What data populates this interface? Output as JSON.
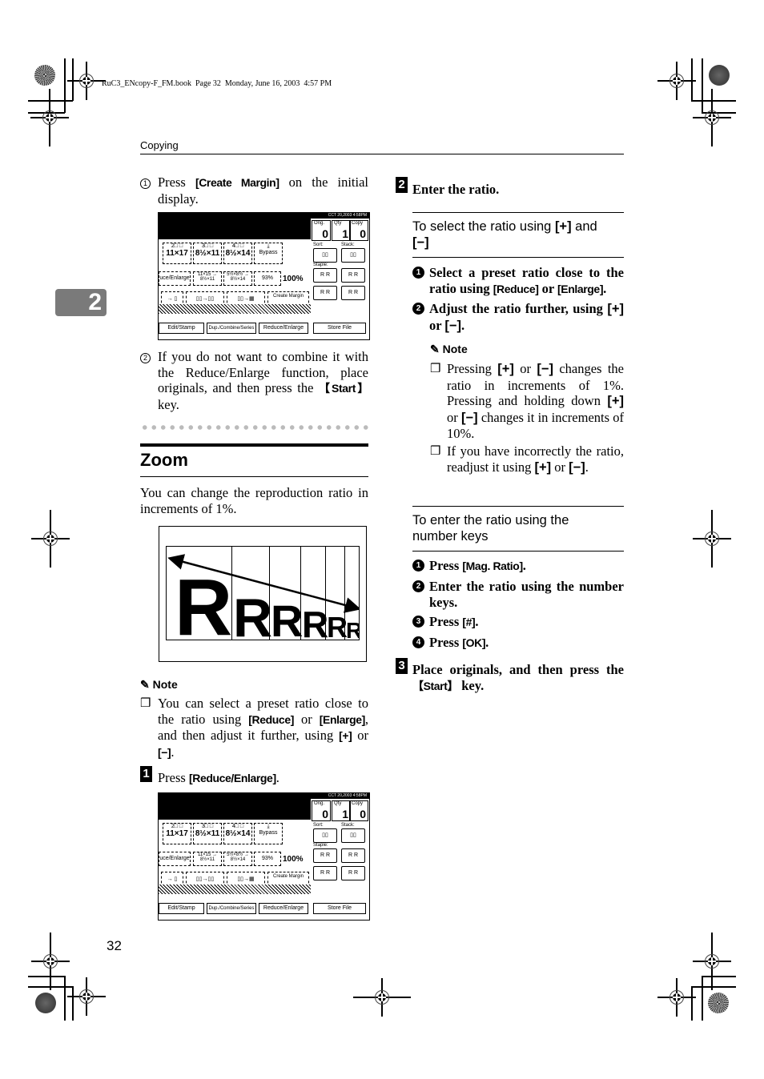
{
  "print_meta": "RuC3_ENcopy-F_FM.book  Page 32  Monday, June 16, 2003  4:57 PM",
  "running_header": "Copying",
  "chapter_tab": "2",
  "page_number": "32",
  "left_column": {
    "substep1": {
      "marker": "1",
      "pre": "Press ",
      "key": "[Create Margin]",
      "post": " on the initial display."
    },
    "substep2": {
      "marker": "2",
      "text": "If you do not want to combine it with the Reduce/Enlarge function, place originals, and then press the ",
      "key": "【Start】",
      "post": " key."
    },
    "section_title": "Zoom",
    "intro": "You can change the reproduction ratio in increments of 1%.",
    "figure": {
      "letter": "R",
      "columns": 6
    },
    "note": {
      "title": "Note",
      "items": [
        {
          "t1": "You can select a preset ratio close to the ratio using ",
          "k1": "[Reduce]",
          "t2": " or ",
          "k2": "[Enlarge]",
          "t3": ", and then adjust it further, using ",
          "k3": "[+]",
          "t4": " or ",
          "k4": "[−]",
          "t5": "."
        }
      ]
    },
    "step1": {
      "number": "1",
      "pre": "Press ",
      "key": "[Reduce/Enlarge]",
      "post": "."
    }
  },
  "copier_screen": {
    "status_time": "CCT  20,2003  4:58PM",
    "counters": [
      {
        "label": "Orig.",
        "value": "0"
      },
      {
        "label": "Qty",
        "value": "1"
      },
      {
        "label": "Copy",
        "value": "0"
      }
    ],
    "trays": [
      {
        "label": "2□ □",
        "size": "11×17"
      },
      {
        "label": "3□ □",
        "size": "8½×11"
      },
      {
        "label": "4□ □",
        "size": "8½×14"
      },
      {
        "label": "⤓",
        "size": "Bypass"
      }
    ],
    "ratio_buttons": [
      "uce/Enlarge",
      "11×15 → 8½×11",
      "5½×8½ → 8½×14",
      "93%"
    ],
    "ratio_display": "100%",
    "create_margin": "Create Margin",
    "sort_label": "Sort:",
    "stack_label": "Stack:",
    "staple_label": "Staple:",
    "bottom_tabs": [
      "Edit/Stamp",
      "Dup./Combine/Series",
      "Reduce/Enlarge"
    ],
    "store_file": "Store File"
  },
  "right_column": {
    "step2": {
      "number": "2",
      "text": "Enter the ratio."
    },
    "sub_a": {
      "heading_pre": "To select the ratio using ",
      "heading_k1": "[+]",
      "heading_mid": " and ",
      "heading_k2": "[−]",
      "items": [
        {
          "n": "1",
          "t1": "Select a preset ratio close to the ratio using ",
          "k1": "[Reduce]",
          "t2": " or ",
          "k2": "[Enlarge]",
          "t3": "."
        },
        {
          "n": "2",
          "t1": "Adjust the ratio further, using ",
          "k1": "[+]",
          "t2": " or ",
          "k2": "[−]",
          "t3": "."
        }
      ],
      "note_title": "Note",
      "note_items": [
        {
          "t1": "Pressing ",
          "k1": "[+]",
          "t2": " or ",
          "k2": "[−]",
          "t3": " changes the ratio in increments of 1%. Pressing and holding down ",
          "k3": "[+]",
          "t4": " or ",
          "k4": "[−]",
          "t5": " changes it in increments of 10%."
        },
        {
          "t1": "If you have incorrectly the ratio, readjust it using ",
          "k1": "[+]",
          "t2": " or ",
          "k2": "[−]",
          "t3": "."
        }
      ]
    },
    "sub_b": {
      "heading": "To enter the ratio using the number keys",
      "items": [
        {
          "n": "1",
          "pre": "Press ",
          "key": "[Mag. Ratio]",
          "post": "."
        },
        {
          "n": "2",
          "pre": "Enter the ratio using the number keys.",
          "key": "",
          "post": ""
        },
        {
          "n": "3",
          "pre": "Press ",
          "key": "[#]",
          "post": "."
        },
        {
          "n": "4",
          "pre": "Press ",
          "key": "[OK]",
          "post": "."
        }
      ]
    },
    "step3": {
      "number": "3",
      "pre": "Place originals, and then press the ",
      "key": "【Start】",
      "post": " key."
    }
  }
}
